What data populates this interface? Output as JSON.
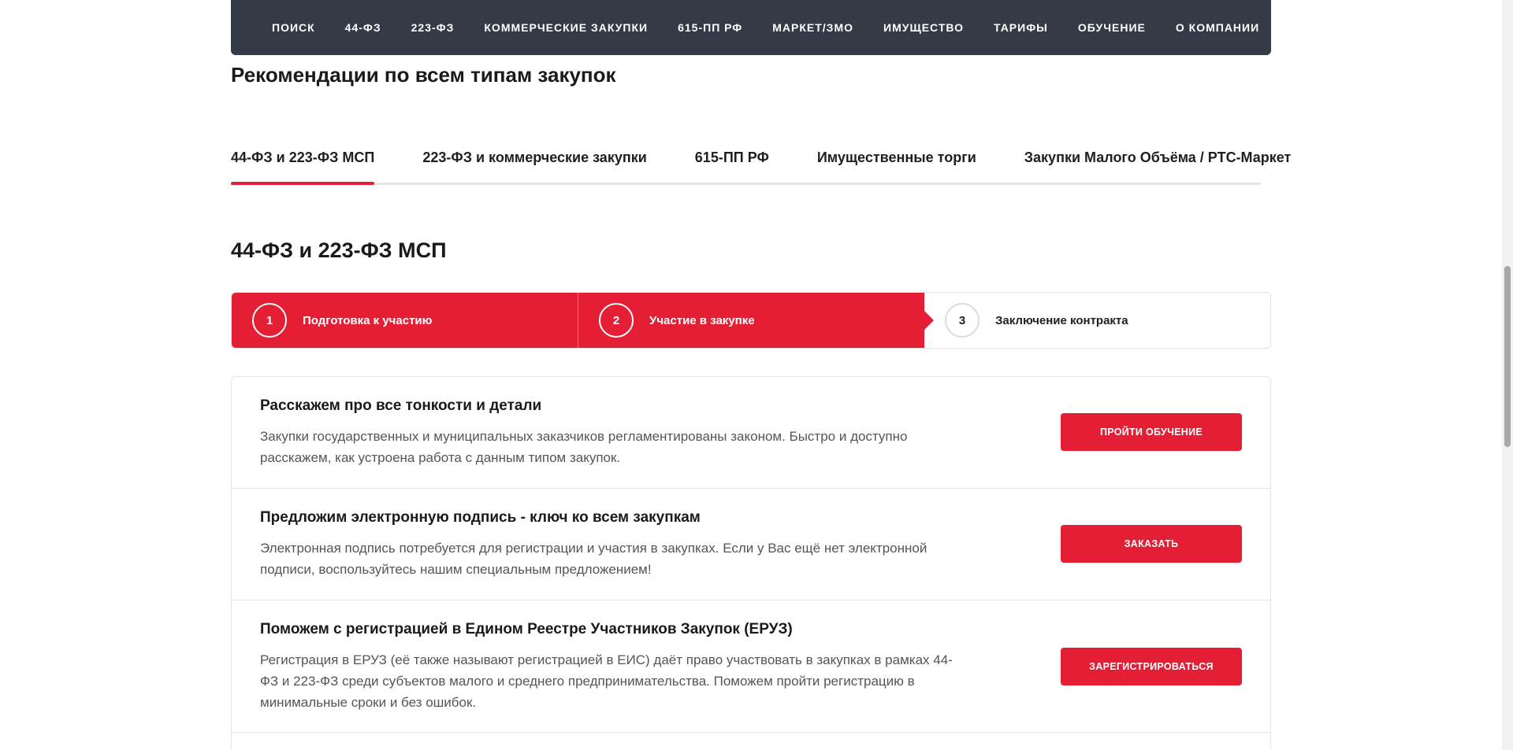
{
  "nav": {
    "items": [
      "Поиск",
      "44-ФЗ",
      "223-ФЗ",
      "Коммерческие закупки",
      "615-ПП РФ",
      "Маркет/ЗМО",
      "Имущество",
      "Тарифы",
      "Обучение",
      "О компании"
    ]
  },
  "page": {
    "title": "Рекомендации по всем типам закупок",
    "section_title": "44-ФЗ и 223-ФЗ МСП"
  },
  "tabs": [
    {
      "label": "44-ФЗ и 223-ФЗ МСП",
      "active": true
    },
    {
      "label": "223-ФЗ и коммерческие закупки",
      "active": false
    },
    {
      "label": "615-ПП РФ",
      "active": false
    },
    {
      "label": "Имущественные торги",
      "active": false
    },
    {
      "label": "Закупки Малого Объёма / РТС-Маркет",
      "active": false
    }
  ],
  "steps": [
    {
      "number": "1",
      "label": "Подготовка к участию",
      "state": "done"
    },
    {
      "number": "2",
      "label": "Участие в закупке",
      "state": "done"
    },
    {
      "number": "3",
      "label": "Заключение контракта",
      "state": "todo"
    }
  ],
  "cards": [
    {
      "title": "Расскажем про все тонкости и детали",
      "text": "Закупки государственных и муниципальных заказчиков регламентированы законом. Быстро и доступно расскажем, как устроена работа с данным типом закупок.",
      "button": "Пройти обучение"
    },
    {
      "title": "Предложим электронную подпись - ключ ко всем закупкам",
      "text": "Электронная подпись потребуется для регистрации и участия в закупках. Если у Вас ещё нет электронной подписи, воспользуйтесь нашим специальным предложением!",
      "button": "Заказать"
    },
    {
      "title": "Поможем с регистрацией в Едином Реестре Участников Закупок (ЕРУЗ)",
      "text": "Регистрация в ЕРУЗ (её также называют регистрацией в ЕИС) даёт право участвовать в закупках в рамках 44-ФЗ и 223-ФЗ среди субъектов малого и среднего предпринимательства. Поможем пройти регистрацию в минимальные сроки и без ошибок.",
      "button": "Зарегистрироваться"
    }
  ],
  "colors": {
    "accent": "#e31e35",
    "nav_bg": "#343a46"
  }
}
